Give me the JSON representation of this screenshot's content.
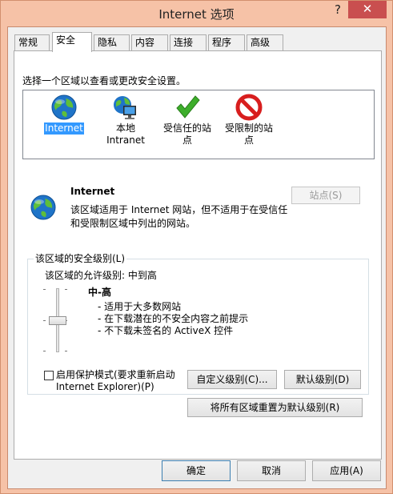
{
  "window": {
    "title": "Internet 选项",
    "help_glyph": "?",
    "close_glyph": "✕"
  },
  "tabs": [
    {
      "label": "常规"
    },
    {
      "label": "安全"
    },
    {
      "label": "隐私"
    },
    {
      "label": "内容"
    },
    {
      "label": "连接"
    },
    {
      "label": "程序"
    },
    {
      "label": "高级"
    }
  ],
  "security": {
    "zone_prompt": "选择一个区域以查看或更改安全设置。",
    "zones": [
      {
        "label": "Internet",
        "icon": "globe-icon",
        "selected": true
      },
      {
        "label": "本地\nIntranet",
        "icon": "intranet-icon",
        "selected": false
      },
      {
        "label": "受信任的站\n点",
        "icon": "trusted-checkmark-icon",
        "selected": false
      },
      {
        "label": "受限制的站\n点",
        "icon": "restricted-icon",
        "selected": false
      }
    ],
    "zone_name": "Internet",
    "zone_description": "该区域适用于 Internet 网站，但不适用于在受信任和受限制区域中列出的网站。",
    "sites_button": "站点(S)",
    "level_group_label": "该区域的安全级别(L)",
    "allowed_levels": "该区域的允许级别: 中到高",
    "level_name": "中-高",
    "level_bullets": [
      "- 适用于大多数网站",
      "- 在下载潜在的不安全内容之前提示",
      "- 不下载未签名的 ActiveX 控件"
    ],
    "protected_mode_label": "启用保护模式(要求重新启动 Internet Explorer)(P)",
    "protected_mode_checked": false,
    "custom_level_button": "自定义级别(C)...",
    "default_level_button": "默认级别(D)",
    "reset_all_button": "将所有区域重置为默认级别(R)"
  },
  "footer": {
    "ok_button": "确定",
    "cancel_button": "取消",
    "apply_button": "应用(A)"
  },
  "colors": {
    "title_bar": "#f6c2a7",
    "close_button": "#c94f4f",
    "selection": "#3399ff",
    "restricted_red": "#d81e1e",
    "trusted_green": "#3dae2b"
  }
}
